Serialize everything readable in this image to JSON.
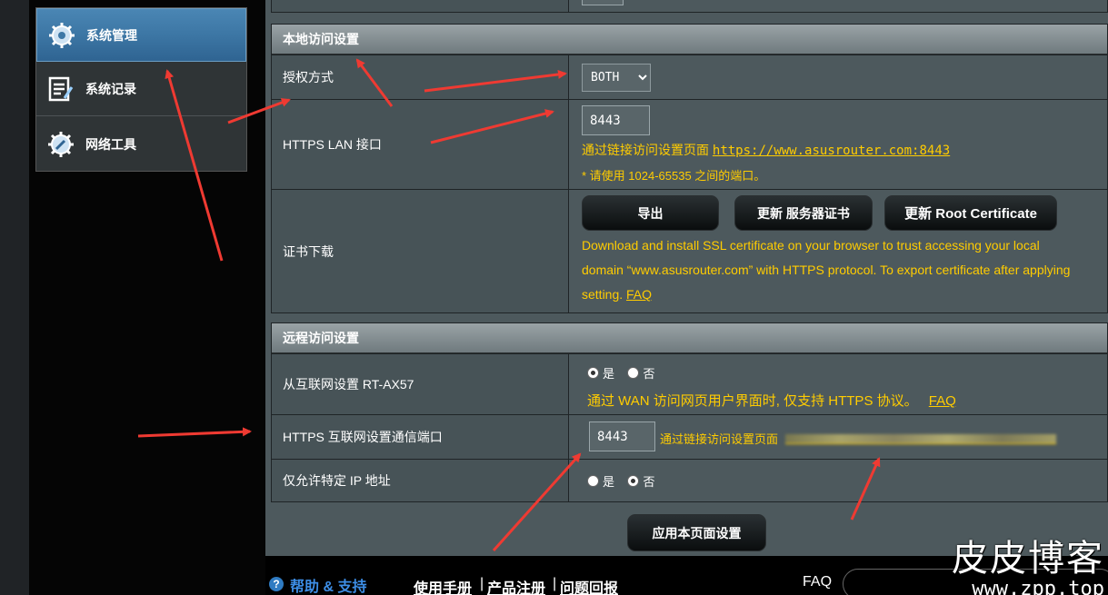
{
  "sidebar": {
    "items": [
      {
        "label": "系统管理",
        "icon": "gear-icon",
        "active": true
      },
      {
        "label": "系统记录",
        "icon": "log-icon",
        "active": false
      },
      {
        "label": "网络工具",
        "icon": "network-tools-icon",
        "active": false
      }
    ]
  },
  "local_access": {
    "title": "本地访问设置",
    "auth_label": "授权方式",
    "auth_value": "BOTH",
    "auth_options": [
      "BOTH"
    ],
    "https_lan_label": "HTTPS LAN 接口",
    "https_lan_port": "8443",
    "https_link_text": "通过链接访问设置页面",
    "https_link_url": "https://www.asusrouter.com:8443",
    "port_hint": "* 请使用 1024-65535 之间的端口。",
    "cert_label": "证书下载",
    "export_btn": "导出",
    "update_server_btn": "更新 服务器证书",
    "update_root_btn": "更新 Root Certificate",
    "cert_desc_1": "Download and install SSL certificate on your browser to trust accessing your local",
    "cert_desc_2": "domain “www.asusrouter.com” with HTTPS protocol. To export certificate after applying",
    "cert_desc_3": "setting.",
    "faq": "FAQ"
  },
  "remote_access": {
    "title": "远程访问设置",
    "wan_label": "从互联网设置 RT-AX57",
    "yes": "是",
    "no": "否",
    "wan_selected": "yes",
    "wan_hint": "通过 WAN 访问网页用户界面时, 仅支持 HTTPS 协议。",
    "faq": "FAQ",
    "https_wan_label": "HTTPS 互联网设置通信端口",
    "https_wan_port": "8443",
    "wan_link_text": "通过链接访问设置页面",
    "ip_label": "仅允许特定 IP 地址",
    "ip_selected": "no"
  },
  "apply_btn": "应用本页面设置",
  "footer": {
    "help": "帮助 & 支持",
    "manual": "使用手册",
    "register": "产品注册",
    "feedback": "问题回报",
    "sep": "|",
    "faq": "FAQ"
  },
  "watermark": {
    "title": "皮皮博客",
    "url": "www.zpp.top"
  },
  "colors": {
    "accent_yellow": "#ffcc00",
    "arrow_red": "#ef3a32",
    "active_blue": "#3e78a6"
  }
}
